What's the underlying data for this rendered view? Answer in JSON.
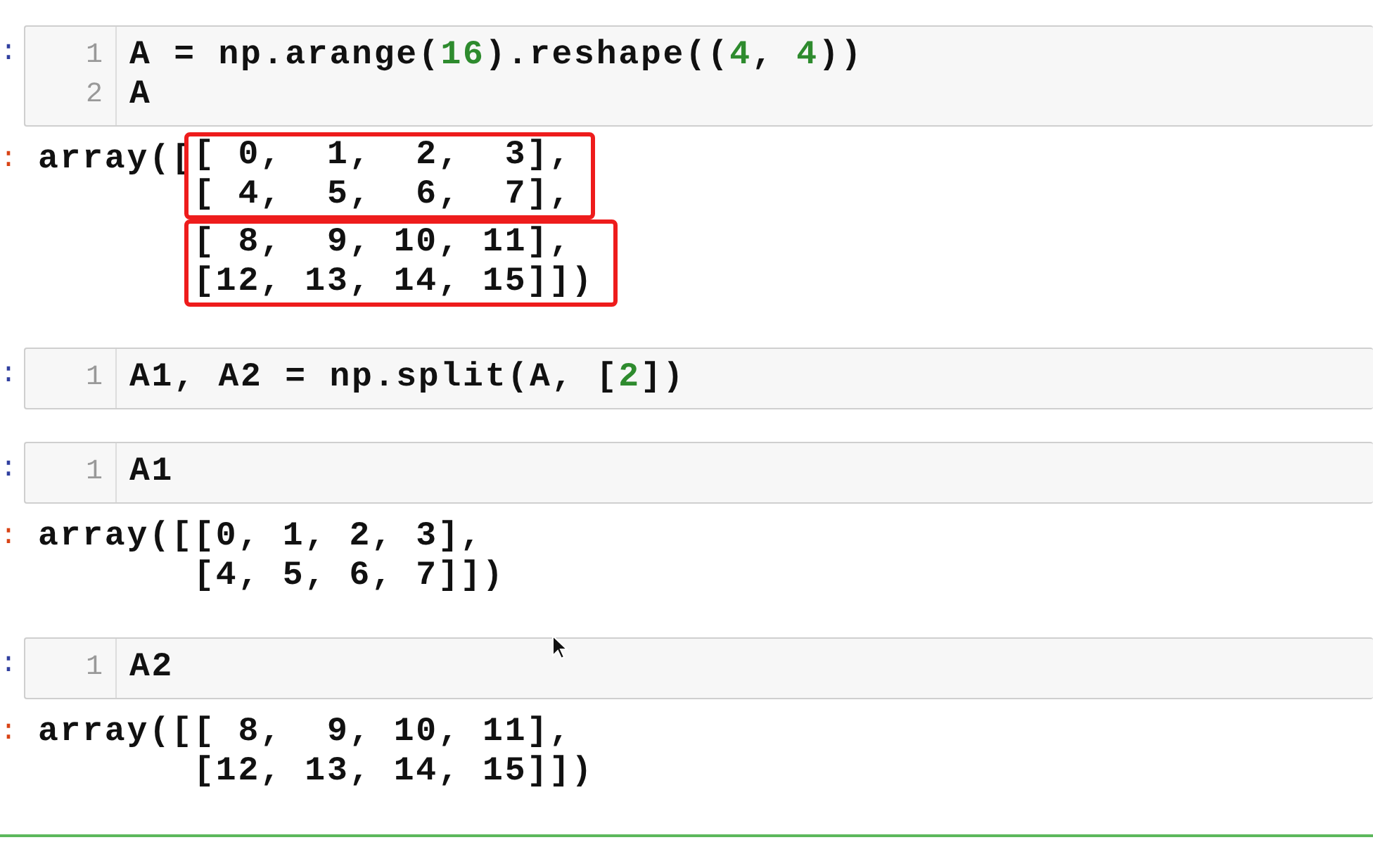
{
  "cells": [
    {
      "in_prompt": ":",
      "input": [
        {
          "number": "1",
          "tokens": [
            {
              "kind": "code",
              "text": "A = np.arange("
            },
            {
              "kind": "number",
              "text": "16"
            },
            {
              "kind": "code",
              "text": ").reshape(("
            },
            {
              "kind": "number",
              "text": "4"
            },
            {
              "kind": "code",
              "text": ", "
            },
            {
              "kind": "number",
              "text": "4"
            },
            {
              "kind": "code",
              "text": "))"
            }
          ]
        },
        {
          "number": "2",
          "tokens": [
            {
              "kind": "code",
              "text": "A"
            }
          ]
        }
      ],
      "output": {
        "out_prompt": ":",
        "prefix": "array([",
        "blocks": [
          {
            "highlighted": true,
            "lines": [
              "[ 0,  1,  2,  3],",
              "[ 4,  5,  6,  7],"
            ]
          },
          {
            "highlighted": true,
            "lines": [
              "[ 8,  9, 10, 11],",
              "[12, 13, 14, 15]])"
            ]
          }
        ]
      }
    },
    {
      "in_prompt": ":",
      "input": [
        {
          "number": "1",
          "tokens": [
            {
              "kind": "code",
              "text": "A1, A2 = np.split(A, ["
            },
            {
              "kind": "number",
              "text": "2"
            },
            {
              "kind": "code",
              "text": "])"
            }
          ]
        }
      ]
    },
    {
      "in_prompt": ":",
      "input": [
        {
          "number": "1",
          "tokens": [
            {
              "kind": "code",
              "text": "A1"
            }
          ]
        }
      ],
      "output": {
        "out_prompt": ":",
        "prefix": "array([",
        "blocks": [
          {
            "highlighted": false,
            "lines": [
              "[0, 1, 2, 3],",
              "[4, 5, 6, 7]])"
            ]
          }
        ]
      }
    },
    {
      "in_prompt": ":",
      "input": [
        {
          "number": "1",
          "tokens": [
            {
              "kind": "code",
              "text": "A2"
            }
          ]
        }
      ],
      "output": {
        "out_prompt": ":",
        "prefix": "array([",
        "blocks": [
          {
            "highlighted": false,
            "lines": [
              "[ 8,  9, 10, 11],",
              "[12, 13, 14, 15]])"
            ]
          }
        ]
      }
    }
  ]
}
